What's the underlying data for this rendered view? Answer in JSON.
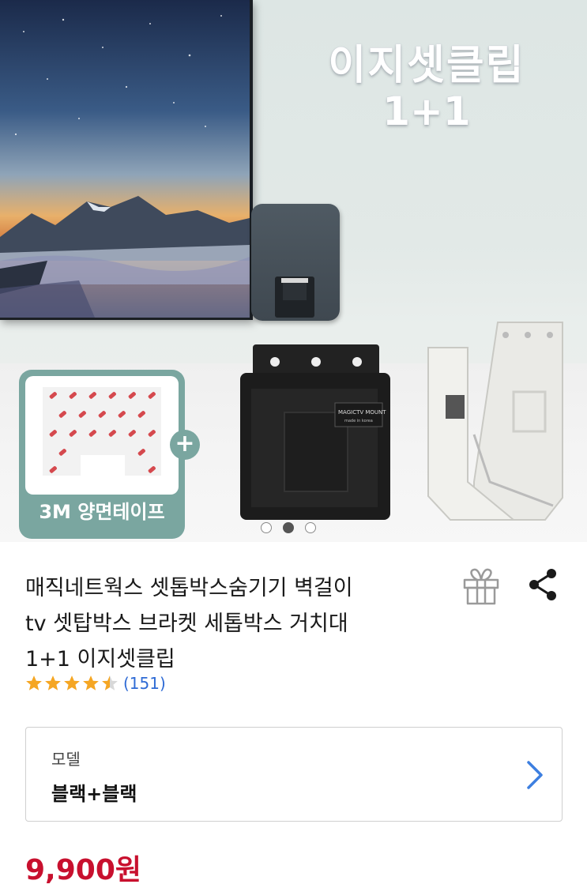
{
  "hero": {
    "title_line1": "이지셋클립",
    "title_line2": "1+1",
    "tape_label": "3M 양면테이프",
    "plus_symbol": "+",
    "bracket_brand": "MAGICTV MOUNT",
    "bracket_sub": "made in korea",
    "carousel_total": 3,
    "carousel_active": 2
  },
  "product": {
    "title_lines": [
      "매직네트웍스 셋톱박스숨기기 벽걸이",
      "tv 셋탑박스 브라켓 세톱박스 거치대",
      "1+1 이지셋클립"
    ],
    "rating": 4.5,
    "review_count": "(151)"
  },
  "option": {
    "label": "모델",
    "value": "블랙+블랙"
  },
  "price": "9,900원",
  "icons": {
    "gift": "gift-icon",
    "share": "share-icon",
    "chevron": "chevron-right-icon",
    "star": "star-icon"
  },
  "colors": {
    "price": "#c8102e",
    "star": "#f5a623",
    "review_link": "#2f6bd5",
    "chevron": "#3d7fe0",
    "tape_card": "#7aa6a0"
  }
}
